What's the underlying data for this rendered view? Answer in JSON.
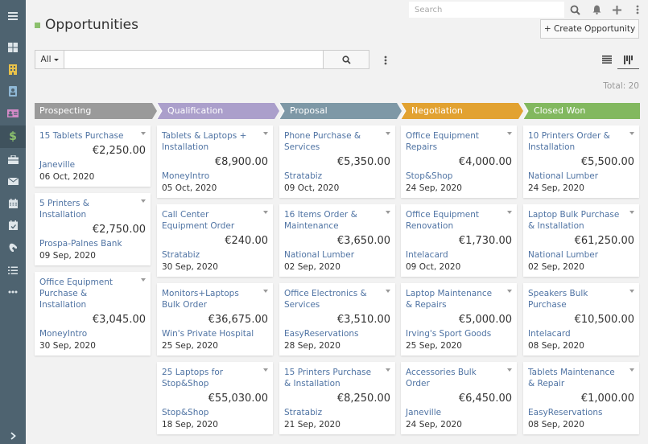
{
  "sidebar": {
    "items": [
      {
        "name": "menu-toggle",
        "icon": "hamburger-icon"
      },
      {
        "name": "home",
        "icon": "dashboard-icon"
      },
      {
        "name": "accounts",
        "icon": "building-icon"
      },
      {
        "name": "contacts",
        "icon": "contact-badge-icon"
      },
      {
        "name": "leads",
        "icon": "id-card-icon"
      },
      {
        "name": "opportunities",
        "icon": "dollar-icon",
        "active": true
      },
      {
        "name": "cases",
        "icon": "briefcase-icon"
      },
      {
        "name": "emails",
        "icon": "envelope-icon"
      },
      {
        "name": "calendar",
        "icon": "calendar-icon"
      },
      {
        "name": "meetings",
        "icon": "calendar-check-icon"
      },
      {
        "name": "calls",
        "icon": "phone-icon"
      },
      {
        "name": "tasks",
        "icon": "tasks-icon"
      },
      {
        "name": "more",
        "icon": "ellipsis-icon"
      },
      {
        "name": "expand",
        "icon": "chevron-right-icon"
      }
    ]
  },
  "topbar": {
    "search_placeholder": "Search"
  },
  "header": {
    "title": "Opportunities",
    "create_label": "+ Create Opportunity",
    "accent_color": "#8cc06d"
  },
  "filter": {
    "scope_label": "All",
    "query_value": ""
  },
  "total_label": "Total: 20",
  "stages": [
    {
      "label": "Prospecting",
      "color": "#9a9a9a"
    },
    {
      "label": "Qualification",
      "color": "#ab9fcb"
    },
    {
      "label": "Proposal",
      "color": "#7e98a6"
    },
    {
      "label": "Negotiation",
      "color": "#e2a231"
    },
    {
      "label": "Closed Won",
      "color": "#82b85f"
    }
  ],
  "columns": [
    {
      "cards": [
        {
          "title": "15 Tablets Purchase",
          "amount": "€2,250.00",
          "account": "Janeville",
          "date": "06 Oct, 2020"
        },
        {
          "title": "5 Printers & Installation",
          "amount": "€2,750.00",
          "account": "Prospa-Palnes Bank",
          "date": "09 Sep, 2020"
        },
        {
          "title": "Office Equipment Purchase & Installation",
          "amount": "€3,045.00",
          "account": "MoneyIntro",
          "date": "30 Sep, 2020"
        }
      ]
    },
    {
      "cards": [
        {
          "title": "Tablets & Laptops + Installation",
          "amount": "€8,900.00",
          "account": "MoneyIntro",
          "date": "05 Oct, 2020"
        },
        {
          "title": "Call Center Equipment Order",
          "amount": "€240.00",
          "account": "Stratabiz",
          "date": "30 Sep, 2020"
        },
        {
          "title": "Monitors+Laptops Bulk Order",
          "amount": "€36,675.00",
          "account": "Win's Private Hospital",
          "date": "25 Sep, 2020"
        },
        {
          "title": "25 Laptops for Stop&Shop",
          "amount": "€55,030.00",
          "account": "Stop&Shop",
          "date": "18 Sep, 2020"
        }
      ]
    },
    {
      "cards": [
        {
          "title": "Phone Purchase & Services",
          "amount": "€5,350.00",
          "account": "Stratabiz",
          "date": "09 Oct, 2020"
        },
        {
          "title": "16 Items Order & Maintenance",
          "amount": "€3,650.00",
          "account": "National Lumber",
          "date": "02 Sep, 2020"
        },
        {
          "title": "Office Electronics & Services",
          "amount": "€3,510.00",
          "account": "EasyReservations",
          "date": "28 Sep, 2020"
        },
        {
          "title": "15 Printers Purchase & Installation",
          "amount": "€8,250.00",
          "account": "Stratabiz",
          "date": "21 Sep, 2020"
        }
      ]
    },
    {
      "cards": [
        {
          "title": "Office Equipment Repairs",
          "amount": "€4,000.00",
          "account": "Stop&Shop",
          "date": "24 Sep, 2020"
        },
        {
          "title": "Office Equipment Renovation",
          "amount": "€1,730.00",
          "account": "Intelacard",
          "date": "09 Oct, 2020"
        },
        {
          "title": "Laptop Maintenance & Repairs",
          "amount": "€5,000.00",
          "account": "Irving's Sport Goods",
          "date": "25 Sep, 2020"
        },
        {
          "title": "Accessories Bulk Order",
          "amount": "€6,450.00",
          "account": "Janeville",
          "date": "24 Sep, 2020"
        }
      ]
    },
    {
      "cards": [
        {
          "title": "10 Printers Order & Installation",
          "amount": "€5,500.00",
          "account": "National Lumber",
          "date": "24 Sep, 2020"
        },
        {
          "title": "Laptop Bulk Purchase & Installation",
          "amount": "€61,250.00",
          "account": "National Lumber",
          "date": "02 Sep, 2020"
        },
        {
          "title": "Speakers Bulk Purchase",
          "amount": "€10,500.00",
          "account": "Intelacard",
          "date": "08 Sep, 2020"
        },
        {
          "title": "Tablets Maintenance & Repair",
          "amount": "€1,000.00",
          "account": "EasyReservations",
          "date": "08 Sep, 2020"
        }
      ]
    }
  ]
}
